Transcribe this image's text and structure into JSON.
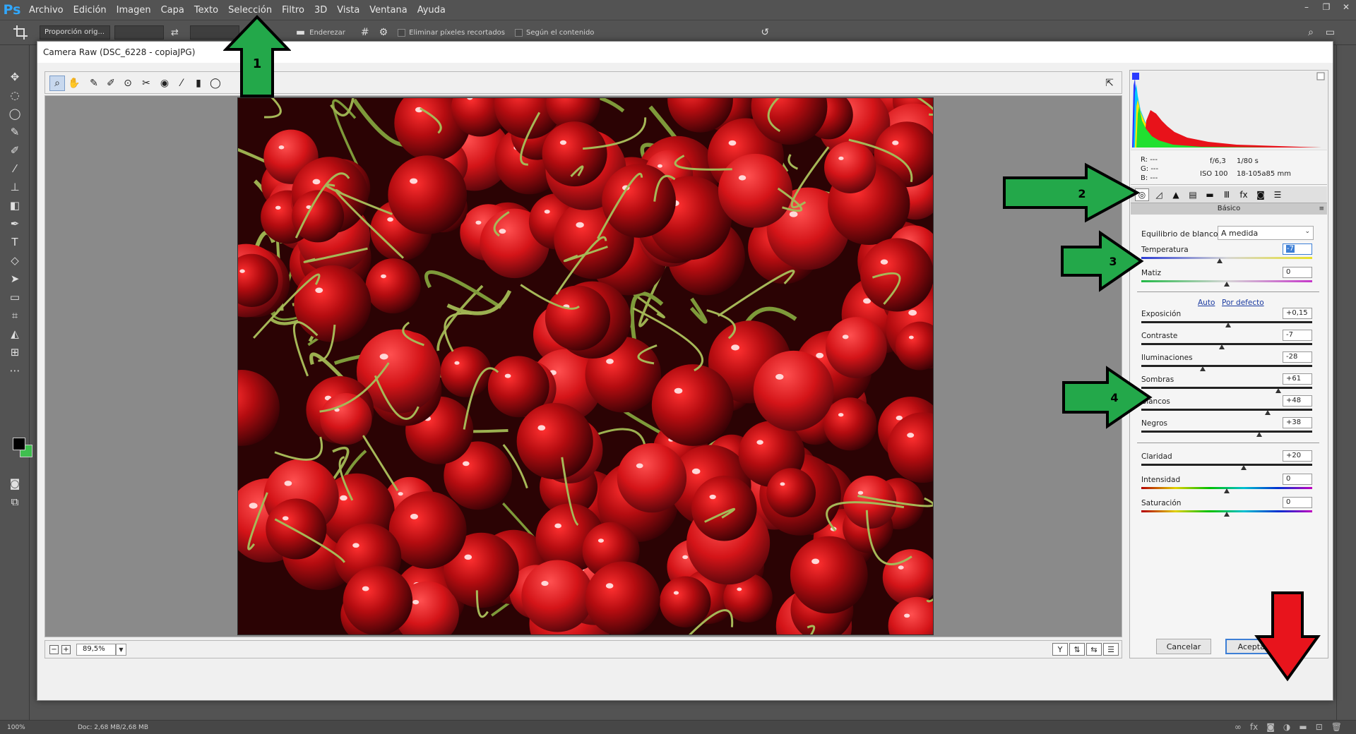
{
  "menubar": {
    "logo": "Ps",
    "items": [
      "Archivo",
      "Edición",
      "Imagen",
      "Capa",
      "Texto",
      "Selección",
      "Filtro",
      "3D",
      "Vista",
      "Ventana",
      "Ayuda"
    ]
  },
  "optionsbar": {
    "ratio_select": "Proporción orig...",
    "straighten_label": "Enderezar",
    "delete_pixels_label": "Eliminar píxeles recortados",
    "content_aware_label": "Según el contenido"
  },
  "dialog": {
    "title": "Camera Raw (DSC_6228 - copiaJPG)",
    "zoom": "89,5%",
    "cancel_label": "Cancelar",
    "accept_label": "Aceptar"
  },
  "histogram_info": {
    "r_label": "R:",
    "r_value": "---",
    "g_label": "G:",
    "g_value": "---",
    "b_label": "B:",
    "b_value": "---",
    "aperture": "f/6,3",
    "shutter": "1/80 s",
    "iso": "ISO 100",
    "lens": "18-105a85 mm"
  },
  "panel": {
    "title": "Básico",
    "wb_label": "Equilibrio de blancos:",
    "wb_value": "A medida",
    "auto_link": "Auto",
    "default_link": "Por defecto",
    "sliders": {
      "temperatura": {
        "label": "Temperatura",
        "value": "-7",
        "level": 0.46
      },
      "matiz": {
        "label": "Matiz",
        "value": "0",
        "level": 0.5
      },
      "exposicion": {
        "label": "Exposición",
        "value": "+0,15",
        "level": 0.51
      },
      "contraste": {
        "label": "Contraste",
        "value": "-7",
        "level": 0.47
      },
      "iluminaciones": {
        "label": "Iluminaciones",
        "value": "-28",
        "level": 0.36
      },
      "sombras": {
        "label": "Sombras",
        "value": "+61",
        "level": 0.8
      },
      "blancos": {
        "label": "Blancos",
        "value": "+48",
        "level": 0.74
      },
      "negros": {
        "label": "Negros",
        "value": "+38",
        "level": 0.69
      },
      "claridad": {
        "label": "Claridad",
        "value": "+20",
        "level": 0.6
      },
      "intensidad": {
        "label": "Intensidad",
        "value": "0",
        "level": 0.5
      },
      "saturacion": {
        "label": "Saturación",
        "value": "0",
        "level": 0.5
      }
    }
  },
  "statusbar": {
    "zoom": "100%",
    "doc": "Doc: 2,68 MB/2,68 MB"
  },
  "annotations": {
    "arrow_1": "1",
    "arrow_2": "2",
    "arrow_3": "3",
    "arrow_4": "4"
  },
  "colors": {
    "annotation_green": "#23a84a",
    "annotation_red": "#e8141c",
    "ps_chrome": "#535353",
    "dialog_bg": "#f0f0f0"
  }
}
